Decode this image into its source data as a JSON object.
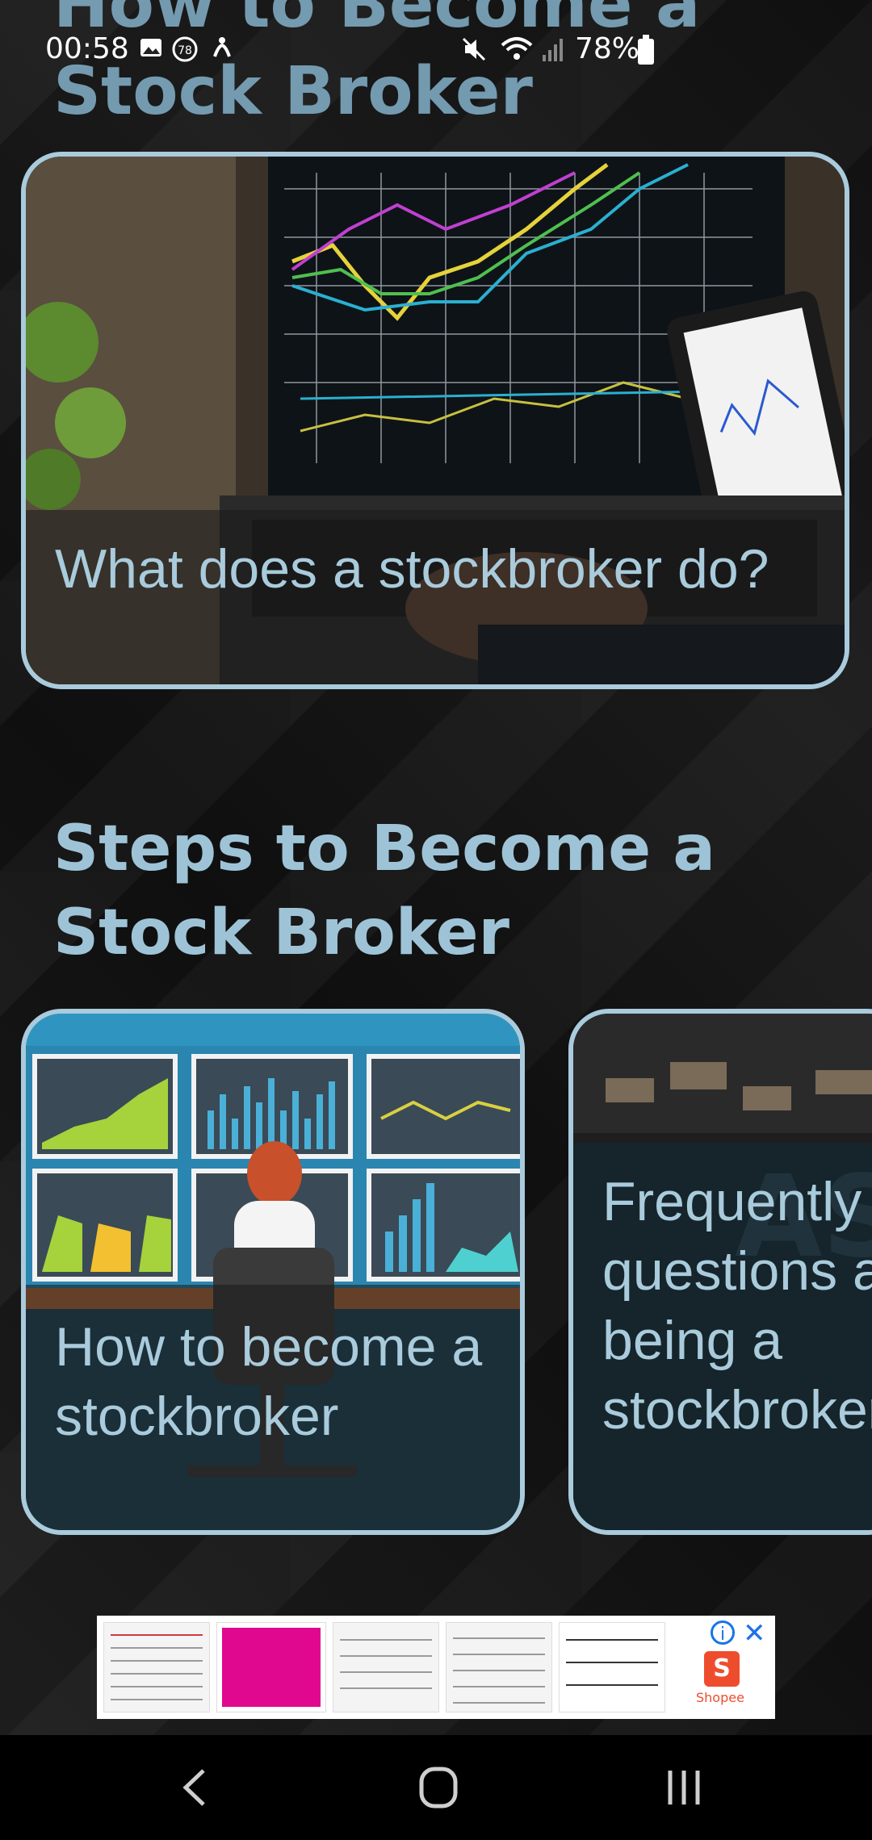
{
  "status_bar": {
    "time": "00:58",
    "battery": "78%",
    "notification_badge": "78",
    "icons": [
      "gallery-icon",
      "badge-icon",
      "accessibility-icon",
      "mute-icon",
      "wifi-icon",
      "signal-icon",
      "battery-icon"
    ]
  },
  "header": {
    "title": "How to Become a Stock Broker"
  },
  "cards": {
    "what_does": {
      "label": "What does a stockbroker do?"
    },
    "how_to": {
      "label": "How to become a stockbroker"
    },
    "faq": {
      "label": "Frequently asked questions about being a stockbroker"
    }
  },
  "sections": {
    "steps_title": "Steps to Become a Stock Broker"
  },
  "ad": {
    "brand": "Shopee"
  },
  "colors": {
    "accent": "#a9cbdc",
    "title": "#9ec3d6",
    "background": "#141414"
  }
}
